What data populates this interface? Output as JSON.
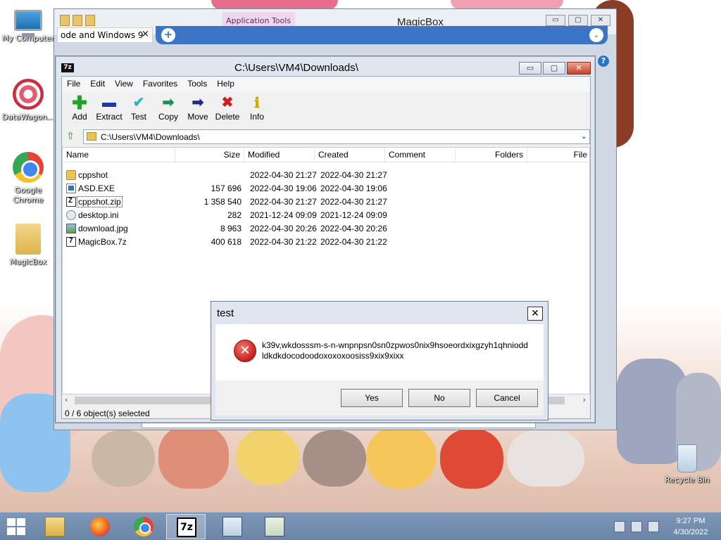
{
  "desktop": {
    "icons": [
      {
        "label": "My Computer",
        "icon": "computer-icon"
      },
      {
        "label": "DataWagon...",
        "icon": "datawagon-icon"
      },
      {
        "label": "Google Chrome",
        "icon": "chrome-icon"
      },
      {
        "label": "MagicBox",
        "icon": "folder-icon"
      }
    ],
    "recycle_bin": "Recycle Bin"
  },
  "magicbox_window": {
    "title": "MagicBox",
    "app_tools_label": "Application Tools",
    "tab_label": "ode and Windows 9",
    "tab_close": "×",
    "new_tab": "+",
    "chevron": "⌄",
    "help": "?",
    "controls": {
      "minimize": "▭",
      "maximize": "▢",
      "close": "✕"
    }
  },
  "zip_window": {
    "title": "C:\\Users\\VM4\\Downloads\\",
    "logo": "7z",
    "controls": {
      "minimize": "▭",
      "maximize": "▢",
      "close": "✕"
    },
    "menu": [
      "File",
      "Edit",
      "View",
      "Favorites",
      "Tools",
      "Help"
    ],
    "toolbar": [
      {
        "label": "Add",
        "glyph": "✚",
        "icon": "add-icon"
      },
      {
        "label": "Extract",
        "glyph": "▬",
        "icon": "extract-icon"
      },
      {
        "label": "Test",
        "glyph": "✔",
        "icon": "test-icon"
      },
      {
        "label": "Copy",
        "glyph": "➡",
        "icon": "copy-icon"
      },
      {
        "label": "Move",
        "glyph": "➡",
        "icon": "move-icon"
      },
      {
        "label": "Delete",
        "glyph": "✖",
        "icon": "delete-icon"
      },
      {
        "label": "Info",
        "glyph": "ℹ",
        "icon": "info-icon"
      }
    ],
    "address": "C:\\Users\\VM4\\Downloads\\",
    "columns": [
      "Name",
      "Size",
      "Modified",
      "Created",
      "Comment",
      "Folders",
      "File"
    ],
    "files": [
      {
        "name": "cppshot",
        "size": "",
        "modified": "2022-04-30 21:27",
        "created": "2022-04-30 21:27",
        "type": "folder"
      },
      {
        "name": "ASD.EXE",
        "size": "157 696",
        "modified": "2022-04-30 19:06",
        "created": "2022-04-30 19:06",
        "type": "exe"
      },
      {
        "name": "cppshot.zip",
        "size": "1 358 540",
        "modified": "2022-04-30 21:27",
        "created": "2022-04-30 21:27",
        "type": "zip"
      },
      {
        "name": "desktop.ini",
        "size": "282",
        "modified": "2021-12-24 09:09",
        "created": "2021-12-24 09:09",
        "type": "ini"
      },
      {
        "name": "download.jpg",
        "size": "8 963",
        "modified": "2022-04-30 20:26",
        "created": "2022-04-30 20:26",
        "type": "jpg"
      },
      {
        "name": "MagicBox.7z",
        "size": "400 618",
        "modified": "2022-04-30 21:22",
        "created": "2022-04-30 21:22",
        "type": "sz"
      }
    ],
    "status": "0 / 6 object(s) selected"
  },
  "dialog": {
    "title": "test",
    "close": "✕",
    "message": "k39v,wkdosssm-s-n-wnpnpsn0sn0zpwos0nix9hsoeordxixgzyh1qhniodd​ldkdkdocodoodoxoxoxoosiss9xix9xixx",
    "buttons": [
      "Yes",
      "No",
      "Cancel"
    ]
  },
  "taskbar": {
    "apps": [
      "file-explorer",
      "firefox",
      "chrome",
      "7-zip",
      "app-window-1",
      "app-window-2"
    ],
    "time": "9:27 PM",
    "date": "4/30/2022"
  }
}
